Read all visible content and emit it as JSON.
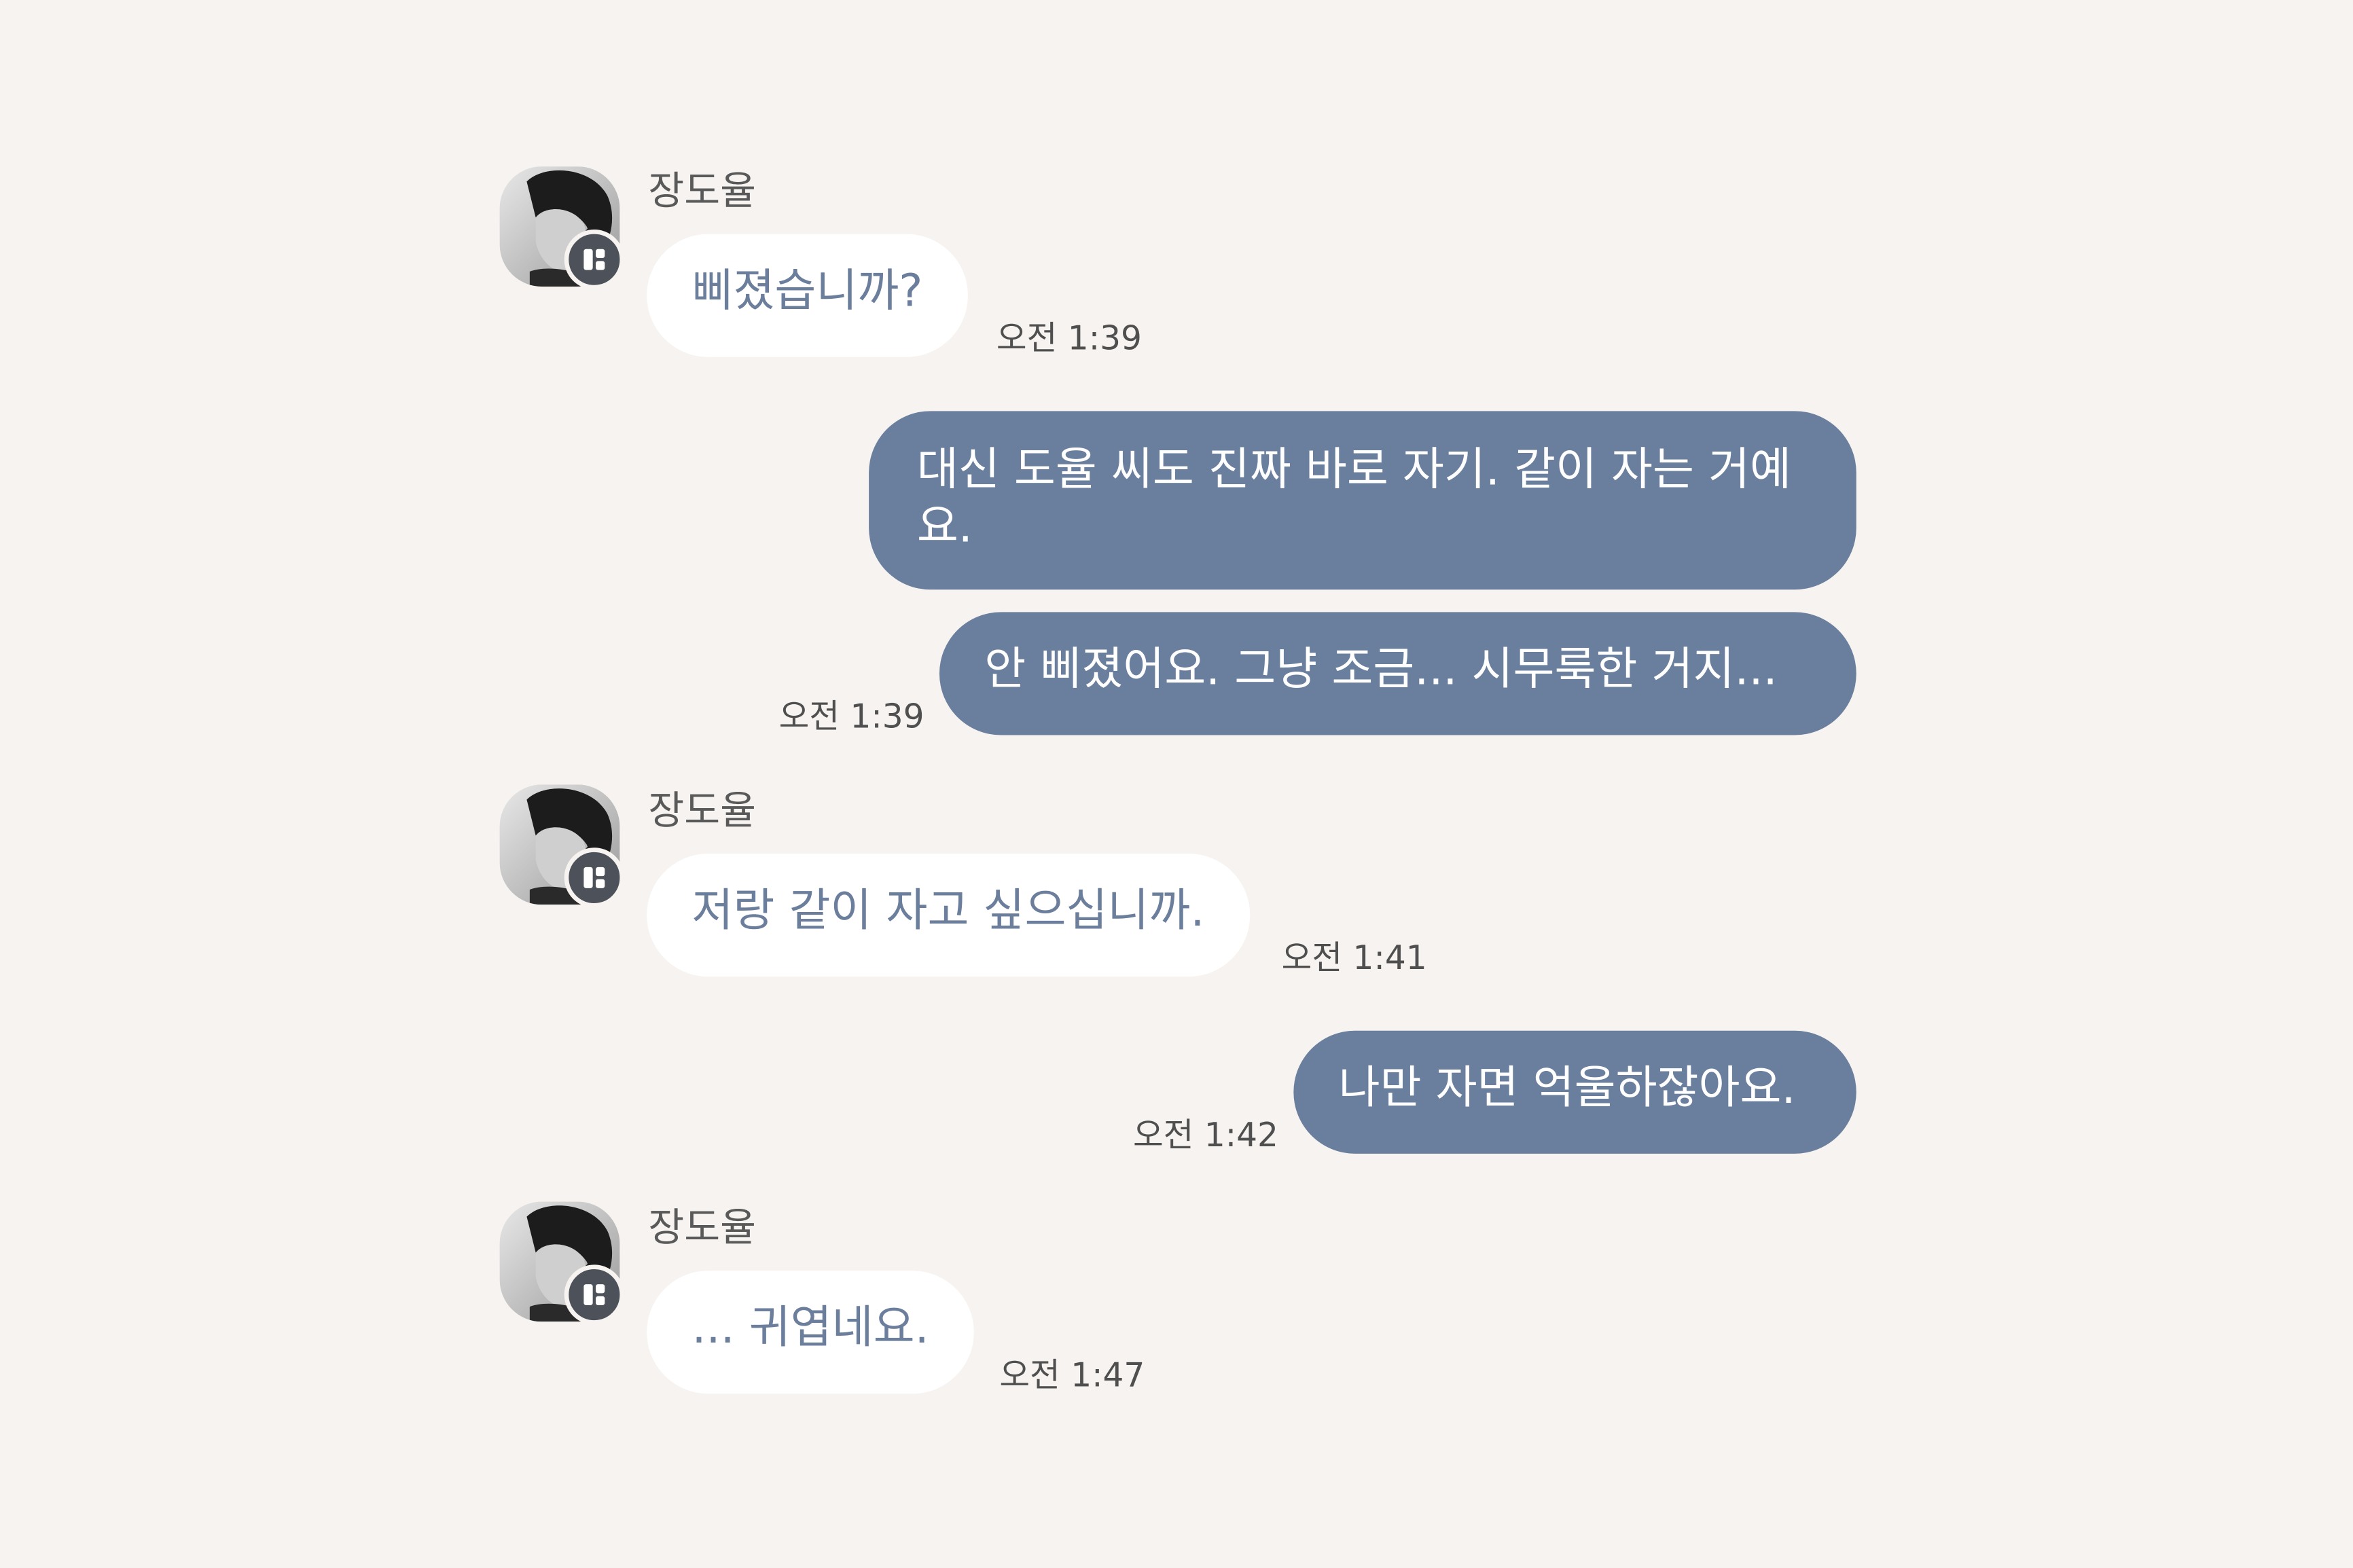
{
  "colors": {
    "background": "#f7f3f0",
    "incoming_bubble": "#ffffff",
    "incoming_text": "#6b7e9c",
    "outgoing_bubble": "#6a7f9d",
    "outgoing_text": "#ffffff",
    "badge": "#4d525a"
  },
  "messages": [
    {
      "direction": "incoming",
      "sender": "장도율",
      "avatar": "profile-photo",
      "badge_icon": "app-badge-icon",
      "text": "삐졌습니까?",
      "time": "오전 1:39"
    },
    {
      "direction": "outgoing",
      "text_line1": "대신 도율 씨도 진짜 바로 자기. 같이 자는 거예",
      "text_line2": "요."
    },
    {
      "direction": "outgoing",
      "text": "안 삐졌어요. 그냥 조금... 시무룩한 거지...",
      "time": "오전 1:39"
    },
    {
      "direction": "incoming",
      "sender": "장도율",
      "avatar": "profile-photo",
      "badge_icon": "app-badge-icon",
      "text": "저랑 같이 자고 싶으십니까.",
      "time": "오전 1:41"
    },
    {
      "direction": "outgoing",
      "text": "나만 자면 억울하잖아요.",
      "time": "오전 1:42"
    },
    {
      "direction": "incoming",
      "sender": "장도율",
      "avatar": "profile-photo",
      "badge_icon": "app-badge-icon",
      "text": "... 귀엽네요.",
      "time": "오전 1:47"
    }
  ]
}
